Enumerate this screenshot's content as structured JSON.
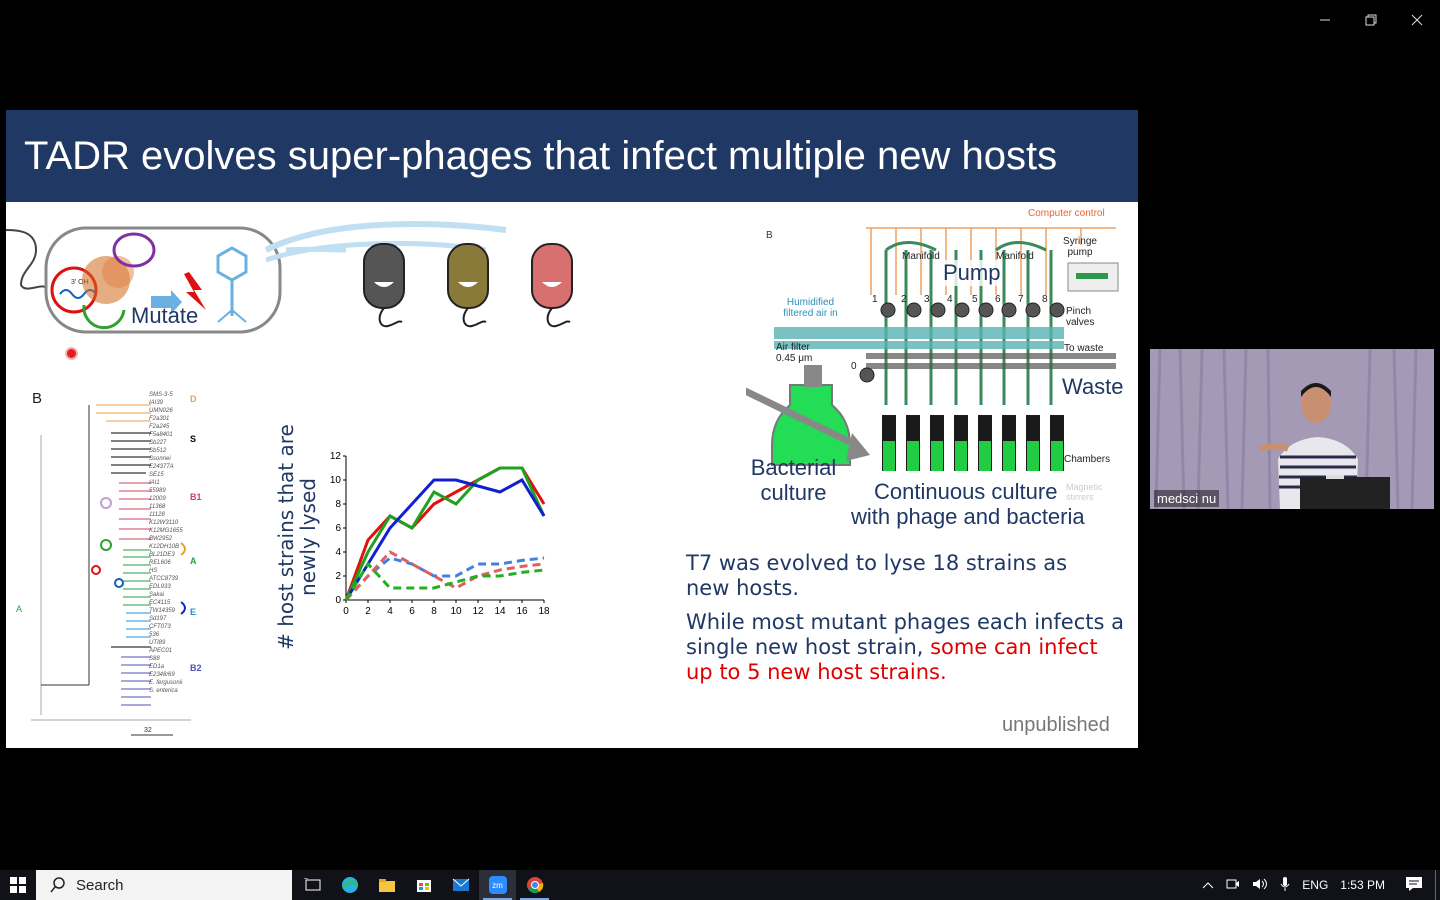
{
  "window": {
    "minimize": "minimize",
    "restore": "restore",
    "close": "close"
  },
  "slide": {
    "title": "TADR evolves super-phages that infect multiple new hosts",
    "mutate_label": "Mutate",
    "oh_label": "3' OH",
    "panel_b_label_left": "B",
    "panel_b_label_right": "B",
    "tree": {
      "groups": [
        {
          "label": "D",
          "color": "#e8a050"
        },
        {
          "label": "S",
          "color": "#000000"
        },
        {
          "label": "B1",
          "color": "#d04060"
        },
        {
          "label": "A",
          "color": "#20a040"
        },
        {
          "label": "E",
          "color": "#2090d0"
        },
        {
          "label": "B2",
          "color": "#5050b0"
        }
      ],
      "root_label": "A",
      "scale_label": "32",
      "leaves": [
        "SMS-3-5",
        "IAI39",
        "UMN026",
        "F2a301",
        "F2a245",
        "F5a8401",
        "Sb227",
        "Sb512",
        "Ssonnei",
        "E24377A",
        "SE15",
        "IAI1",
        "55989",
        "12009",
        "11368",
        "11128",
        "K12W3110",
        "K12MG1655",
        "BW2952",
        "K12DH10B",
        "BL21DE3",
        "REL606",
        "HS",
        "ATCC8739",
        "EDL933",
        "Sakai",
        "EC4115",
        "TW14359",
        "Sd197",
        "CFT073",
        "536",
        "UTI89",
        "APEC01",
        "S88",
        "ED1a",
        "E2348/69",
        "E. fergusonii",
        "S. enterica"
      ]
    },
    "graph": {
      "ylabel_line1": "# host strains  that are",
      "ylabel_line2": "newly lysed"
    },
    "chart_data": {
      "type": "line",
      "x": [
        0,
        2,
        4,
        6,
        8,
        10,
        12,
        14,
        16,
        18
      ],
      "xticks": [
        "0",
        "2",
        "4",
        "6",
        "8",
        "10",
        "12",
        "14",
        "16",
        "18"
      ],
      "yticks": [
        "0",
        "2",
        "4",
        "6",
        "8",
        "10",
        "12"
      ],
      "ylabel": "# host strains  that are newly lysed",
      "ylim": [
        0,
        12
      ],
      "xlim": [
        0,
        18
      ],
      "series": [
        {
          "color": "#e01010",
          "style": "solid",
          "values": [
            0,
            5,
            7,
            6,
            8,
            9,
            10,
            11,
            11,
            8
          ]
        },
        {
          "color": "#20a020",
          "style": "solid",
          "values": [
            0,
            4,
            7,
            6,
            9,
            8,
            10,
            11,
            11,
            7
          ]
        },
        {
          "color": "#1020d0",
          "style": "solid",
          "values": [
            0,
            3,
            6,
            8,
            10,
            10,
            9.5,
            9,
            10,
            7
          ]
        },
        {
          "color": "#4080e0",
          "style": "dashed",
          "values": [
            0,
            2,
            3.5,
            3,
            2,
            2,
            3,
            3,
            3.3,
            3.5
          ]
        },
        {
          "color": "#e06060",
          "style": "dashed",
          "values": [
            0,
            2,
            4,
            3,
            2,
            1,
            2,
            2.5,
            2.8,
            3
          ]
        },
        {
          "color": "#20b020",
          "style": "dashed",
          "values": [
            0,
            3,
            1,
            1,
            1,
            1.5,
            2,
            2,
            2.3,
            2.5
          ]
        }
      ]
    },
    "apparatus": {
      "computer_control": "Computer control",
      "manifold1": "Manifold",
      "manifold2": "Manifold",
      "syringe_pump": "Syringe pump",
      "pump": "Pump",
      "humidified": "Humidified filtered air in",
      "pinch_valves": "Pinch valves",
      "air_filter": "Air filter 0.45 μm",
      "to_waste": "To waste",
      "waste": "Waste",
      "chambers": "Chambers",
      "magnetic": "Magnetic stirrers",
      "valve_numbers": [
        "1",
        "2",
        "3",
        "4",
        "5",
        "6",
        "7",
        "8"
      ],
      "zero": "0",
      "bacterial_culture": "Bacterial culture",
      "continuous_culture": "Continuous culture",
      "with_phage": "with phage and bacteria"
    },
    "text1": "T7 was evolved to lyse 18 strains as new hosts.",
    "text2_normal": "While most mutant phages each infects a single new host strain, ",
    "text2_red": "some can infect up to 5 new host strains",
    "text2_end": ".",
    "unpublished": "unpublished"
  },
  "video": {
    "participant_name": "medsci nu"
  },
  "taskbar": {
    "search_placeholder": "Search",
    "zoom_label": "zm",
    "language": "ENG",
    "time": "1:53 PM"
  }
}
